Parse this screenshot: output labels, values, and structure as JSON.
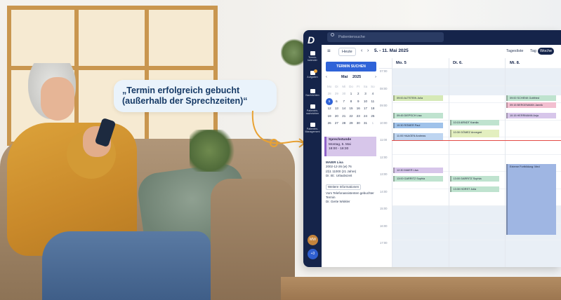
{
  "bubble": {
    "text": "„Termin erfolgreich gebucht\n(außerhalb der Sprechzeiten)“"
  },
  "app": {
    "logo": "D",
    "search_placeholder": "Patientensuche",
    "sidebar": {
      "items": [
        {
          "label": "Termin-kalender",
          "icon": "calendar-icon"
        },
        {
          "label": "Aufgaben",
          "icon": "tasks-icon",
          "badge": true
        },
        {
          "label": "Nachrichten",
          "icon": "chat-icon"
        },
        {
          "label": "Patienten-nachrichten",
          "icon": "messages-icon"
        },
        {
          "label": "Patienten-Management",
          "icon": "patients-icon"
        }
      ],
      "avatar": "MW",
      "plus": "+3"
    },
    "toolbar": {
      "menu": "≡",
      "today": "Heute",
      "prev": "‹",
      "next": "›",
      "range": "5. - 11. Mai 2025",
      "views": [
        "Tagesliste",
        "Tag",
        "Woche"
      ],
      "active_view": "Woche"
    },
    "left": {
      "search_button": "TERMIN SUCHEN",
      "month": "Mai",
      "year": "2025",
      "weekdays": [
        "Mo",
        "Di",
        "Mi",
        "Do",
        "Fr",
        "Sa",
        "So"
      ],
      "weeks": [
        [
          "28",
          "29",
          "30",
          "1",
          "2",
          "3",
          "4"
        ],
        [
          "5",
          "6",
          "7",
          "8",
          "9",
          "10",
          "11"
        ],
        [
          "12",
          "13",
          "14",
          "15",
          "16",
          "17",
          "18"
        ],
        [
          "19",
          "20",
          "21",
          "22",
          "23",
          "24",
          "25"
        ],
        [
          "26",
          "27",
          "28",
          "29",
          "30",
          "31",
          "1"
        ]
      ],
      "selected": "5",
      "sprechstunde": {
        "title": "Sprechstunde",
        "line1": "Montag, 5. Mai",
        "line2": "18:00 - 18:30"
      },
      "patient": {
        "name": "MAIER Lisa",
        "dob": "2002-12-26 (w) 76",
        "phone": "(0)1 11000 (21 Jahre)",
        "notice": "Dr. Bl.: Urlaubszeit",
        "info_button": "Weitere Informationen",
        "note": "Vom Telefonassistenten gebuchter Termin",
        "more": "Dr. Gerte Winkler"
      }
    },
    "calendar": {
      "days": [
        {
          "label": "Mo. 5",
          "num": "5",
          "active": true
        },
        {
          "label": "Di. 6.",
          "num": "",
          "active": false
        },
        {
          "label": "Mi. 8.",
          "num": "",
          "active": false
        }
      ],
      "times": [
        "07:00",
        "08:00",
        "09:00",
        "10:00",
        "11:00",
        "12:00",
        "13:00",
        "14:00",
        "15:00",
        "16:00",
        "17:00"
      ],
      "appointments": [
        {
          "col": 0,
          "slot": 0,
          "text": "09:00 ALTSTEIN Julia",
          "color": "#d6e9b7"
        },
        {
          "col": 0,
          "slot": 1,
          "text": "09:45 DIEPSCH Lisa",
          "color": "#bfe3cf"
        },
        {
          "col": 0,
          "slot": 2,
          "text": "10:30 RÖMER Paul",
          "color": "#9fc2ea"
        },
        {
          "col": 0,
          "slot": 3,
          "text": "11:00 HAAGEN Andreas",
          "color": "#bed5f1"
        },
        {
          "col": 0,
          "slot": 4,
          "text": "12:30 MAIER Lisa",
          "color": "#d7c6ea"
        },
        {
          "col": 0,
          "slot": 5,
          "text": "13:00 GARRITZ Sophia",
          "color": "#bfe3cf"
        },
        {
          "col": 1,
          "slot": 0,
          "text": "10:15 ARNDT Kamila",
          "color": "#bfe3cf"
        },
        {
          "col": 1,
          "slot": 1,
          "text": "10:30 GÓMEZ Annegret",
          "color": "#e3efbf"
        },
        {
          "col": 1,
          "slot": 2,
          "text": "13:00 GARRITZ Sophia",
          "color": "#bfe3cf"
        },
        {
          "col": 1,
          "slot": 3,
          "text": "13:30 HORST Julia",
          "color": "#bfe3cf"
        },
        {
          "col": 2,
          "slot": 0,
          "text": "09:00 SCHENK Gottfried",
          "color": "#bfe3cf"
        },
        {
          "col": 2,
          "slot": 1,
          "text": "09:15 BERGEMANN Jannik",
          "color": "#f3bfd0"
        },
        {
          "col": 2,
          "slot": 2,
          "text": "10:15 HERRMANN Anja",
          "color": "#d7c6ea"
        },
        {
          "col": 2,
          "slot": 3,
          "text": "Externe Fortbildung: Med",
          "color": "#9fb6e3"
        }
      ]
    }
  }
}
